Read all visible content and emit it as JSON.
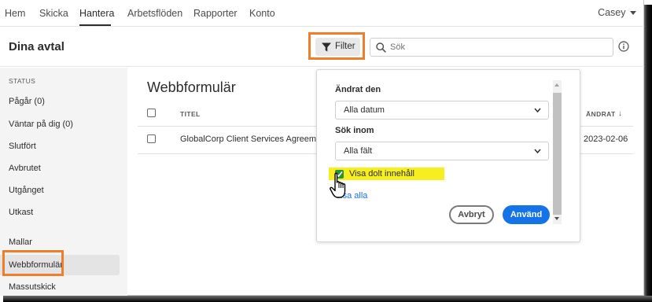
{
  "nav": {
    "items": [
      {
        "label": "Hem"
      },
      {
        "label": "Skicka"
      },
      {
        "label": "Hantera",
        "active": true
      },
      {
        "label": "Arbetsflöden"
      },
      {
        "label": "Rapporter"
      },
      {
        "label": "Konto"
      }
    ],
    "user": "Casey"
  },
  "header": {
    "title": "Dina avtal",
    "filter_label": "Filter",
    "search_placeholder": "Sök"
  },
  "sidebar": {
    "heading": "STATUS",
    "items": [
      {
        "label": "Pågår (0)"
      },
      {
        "label": "Väntar på dig (0)"
      },
      {
        "label": "Slutfört"
      },
      {
        "label": "Avbrutet"
      },
      {
        "label": "Utgånget"
      },
      {
        "label": "Utkast"
      },
      {
        "label": "Mallar"
      },
      {
        "label": "Webbformulär",
        "active": true
      },
      {
        "label": "Massutskick"
      }
    ]
  },
  "main": {
    "title": "Webbformulär",
    "columns": {
      "title": "TITEL",
      "changed": "ÄNDRAT"
    },
    "rows": [
      {
        "name": "GlobalCorp Client Services Agreement",
        "date": "2023-02-06"
      }
    ]
  },
  "filter_popover": {
    "changed_label": "Ändrat den",
    "changed_value": "Alla datum",
    "search_in_label": "Sök inom",
    "search_in_value": "Alla fält",
    "show_hidden_label": "Visa dolt innehåll",
    "show_hidden_checked": true,
    "reset_label": "Visa alla",
    "cancel_label": "Avbryt",
    "apply_label": "Använd"
  },
  "colors": {
    "accent_blue": "#1473e6",
    "highlight_orange": "#ee7d2c",
    "highlight_yellow": "#f7ee1f",
    "checkbox_green": "#2d8f3c"
  }
}
